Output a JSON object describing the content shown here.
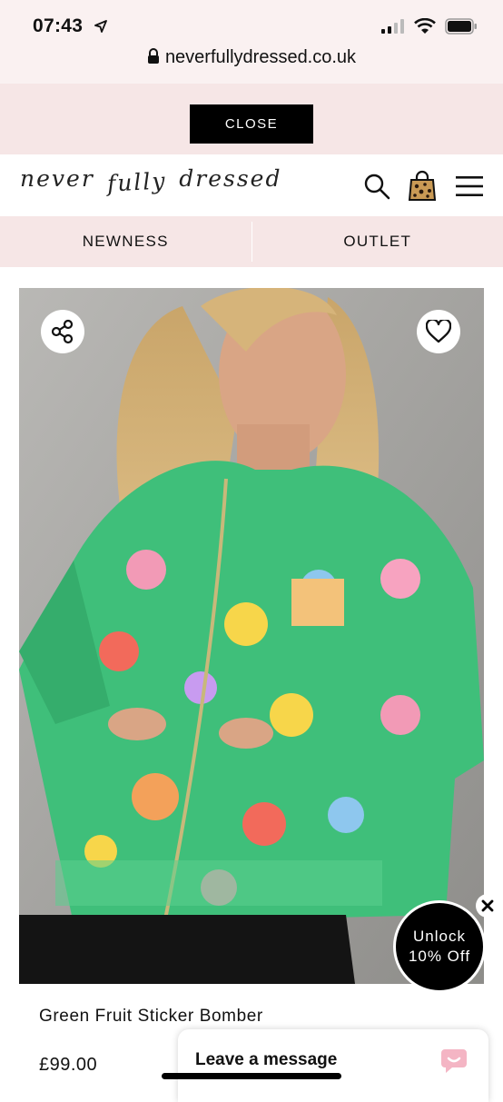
{
  "status_bar": {
    "time": "07:43",
    "url": "neverfullydressed.co.uk"
  },
  "promo_strip": {
    "close_label": "CLOSE"
  },
  "header": {
    "logo_words": [
      "never",
      "fully",
      "dressed"
    ]
  },
  "nav": {
    "items": [
      {
        "label": "NEWNESS"
      },
      {
        "label": "OUTLET"
      }
    ]
  },
  "product": {
    "name": "Green Fruit Sticker Bomber",
    "price": "£99.00",
    "image_icons": [
      "share-icon",
      "heart-icon"
    ]
  },
  "popup": {
    "unlock_line1": "Unlock",
    "unlock_line2": "10% Off"
  },
  "chat": {
    "label": "Leave a message"
  },
  "colors": {
    "pink_bg": "#f6e6e6",
    "jacket_green": "#3fbf7a",
    "black": "#000000"
  }
}
